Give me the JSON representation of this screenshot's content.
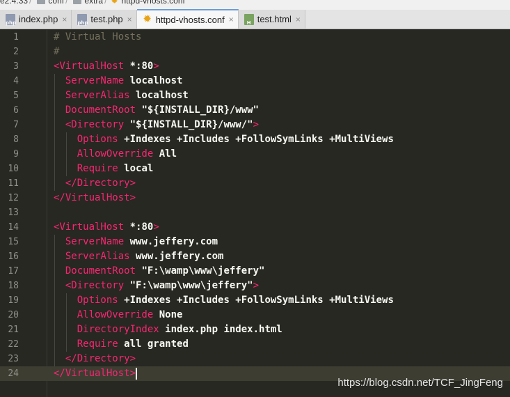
{
  "breadcrumb": {
    "items": [
      "e2.4.33",
      "conf",
      "extra",
      "httpd-vhosts.conf"
    ]
  },
  "tabs": [
    {
      "label": "index.php",
      "icon": "php-file-icon",
      "icon_text": "php",
      "active": false,
      "close": "×"
    },
    {
      "label": "test.php",
      "icon": "php-file-icon",
      "icon_text": "php",
      "active": false,
      "close": "×"
    },
    {
      "label": "httpd-vhosts.conf",
      "icon": "config-file-icon",
      "icon_text": "",
      "active": true,
      "close": "×"
    },
    {
      "label": "test.html",
      "icon": "html-file-icon",
      "icon_text": "H",
      "active": false,
      "close": "×"
    }
  ],
  "editor": {
    "current_line": 24,
    "lines": [
      {
        "n": "1",
        "segs": [
          [
            "c",
            "# Virtual Hosts"
          ]
        ]
      },
      {
        "n": "2",
        "segs": [
          [
            "c",
            "#"
          ]
        ]
      },
      {
        "n": "3",
        "segs": [
          [
            "t",
            "<VirtualHost"
          ],
          [
            "v",
            " *:80"
          ],
          [
            "t",
            ">"
          ]
        ]
      },
      {
        "n": "4",
        "segs": [
          [
            "p",
            "  "
          ],
          [
            "a",
            "ServerName"
          ],
          [
            "v",
            " localhost"
          ]
        ]
      },
      {
        "n": "5",
        "segs": [
          [
            "p",
            "  "
          ],
          [
            "a",
            "ServerAlias"
          ],
          [
            "v",
            " localhost"
          ]
        ]
      },
      {
        "n": "6",
        "segs": [
          [
            "p",
            "  "
          ],
          [
            "a",
            "DocumentRoot"
          ],
          [
            "v",
            " \"${INSTALL_DIR}/www\""
          ]
        ]
      },
      {
        "n": "7",
        "segs": [
          [
            "p",
            "  "
          ],
          [
            "t",
            "<Directory"
          ],
          [
            "v",
            " \"${INSTALL_DIR}/www/\""
          ],
          [
            "t",
            ">"
          ]
        ]
      },
      {
        "n": "8",
        "segs": [
          [
            "p",
            "    "
          ],
          [
            "a",
            "Options"
          ],
          [
            "v",
            " +Indexes +Includes +FollowSymLinks +MultiViews"
          ]
        ]
      },
      {
        "n": "9",
        "segs": [
          [
            "p",
            "    "
          ],
          [
            "a",
            "AllowOverride"
          ],
          [
            "v",
            " All"
          ]
        ]
      },
      {
        "n": "10",
        "segs": [
          [
            "p",
            "    "
          ],
          [
            "a",
            "Require"
          ],
          [
            "v",
            " local"
          ]
        ]
      },
      {
        "n": "11",
        "segs": [
          [
            "p",
            "  "
          ],
          [
            "t",
            "</Directory>"
          ]
        ]
      },
      {
        "n": "12",
        "segs": [
          [
            "t",
            "</VirtualHost>"
          ]
        ]
      },
      {
        "n": "13",
        "segs": []
      },
      {
        "n": "14",
        "segs": [
          [
            "t",
            "<VirtualHost"
          ],
          [
            "v",
            " *:80"
          ],
          [
            "t",
            ">"
          ]
        ]
      },
      {
        "n": "15",
        "segs": [
          [
            "p",
            "  "
          ],
          [
            "a",
            "ServerName"
          ],
          [
            "v",
            " www.jeffery.com"
          ]
        ]
      },
      {
        "n": "16",
        "segs": [
          [
            "p",
            "  "
          ],
          [
            "a",
            "ServerAlias"
          ],
          [
            "v",
            " www.jeffery.com"
          ]
        ]
      },
      {
        "n": "17",
        "segs": [
          [
            "p",
            "  "
          ],
          [
            "a",
            "DocumentRoot"
          ],
          [
            "v",
            " \"F:\\wamp\\www\\jeffery\""
          ]
        ]
      },
      {
        "n": "18",
        "segs": [
          [
            "p",
            "  "
          ],
          [
            "t",
            "<Directory"
          ],
          [
            "v",
            " \"F:\\wamp\\www\\jeffery\""
          ],
          [
            "t",
            ">"
          ]
        ]
      },
      {
        "n": "19",
        "segs": [
          [
            "p",
            "    "
          ],
          [
            "a",
            "Options"
          ],
          [
            "v",
            " +Indexes +Includes +FollowSymLinks +MultiViews"
          ]
        ]
      },
      {
        "n": "20",
        "segs": [
          [
            "p",
            "    "
          ],
          [
            "a",
            "AllowOverride"
          ],
          [
            "v",
            " None"
          ]
        ]
      },
      {
        "n": "21",
        "segs": [
          [
            "p",
            "    "
          ],
          [
            "a",
            "DirectoryIndex"
          ],
          [
            "v",
            " index.php index.html"
          ]
        ]
      },
      {
        "n": "22",
        "segs": [
          [
            "p",
            "    "
          ],
          [
            "a",
            "Require"
          ],
          [
            "v",
            " all granted"
          ]
        ]
      },
      {
        "n": "23",
        "segs": [
          [
            "p",
            "  "
          ],
          [
            "t",
            "</Directory>"
          ]
        ]
      },
      {
        "n": "24",
        "segs": [
          [
            "t",
            "</VirtualHost>"
          ]
        ]
      }
    ]
  },
  "watermark": "https://blog.csdn.net/TCF_JingFeng",
  "colors": {
    "background": "#272822",
    "comment": "#75715e",
    "tag": "#f92672",
    "text": "#f8f8f2",
    "line_numbers": "#90908a"
  }
}
